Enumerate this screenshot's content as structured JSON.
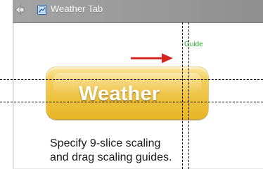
{
  "window": {
    "title": "Weather Tab"
  },
  "icons": {
    "back": "back-arrow-icon",
    "document": "document-icon"
  },
  "tab": {
    "label": "Weather"
  },
  "guide": {
    "label": "Guide"
  },
  "caption": {
    "line1": "Specify 9-slice scaling",
    "line2": "and drag scaling guides."
  },
  "colors": {
    "titlebar": "#9a9a9a",
    "guide_label": "#2ca82c",
    "arrow": "#d3261f",
    "tab_gold": "#edc344",
    "tab_text": "#ffffff"
  }
}
